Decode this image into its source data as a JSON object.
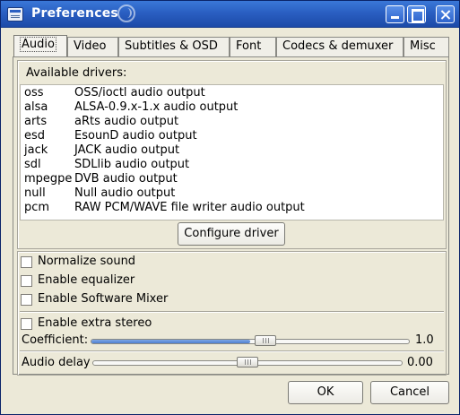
{
  "window": {
    "title": "Preferences"
  },
  "tabs": [
    "Audio",
    "Video",
    "Subtitles & OSD",
    "Font",
    "Codecs & demuxer",
    "Misc"
  ],
  "audio": {
    "drivers_label": "Available drivers:",
    "drivers": [
      {
        "name": "oss",
        "description": "OSS/ioctl audio output"
      },
      {
        "name": "alsa",
        "description": "ALSA-0.9.x-1.x audio output"
      },
      {
        "name": "arts",
        "description": "aRts audio output"
      },
      {
        "name": "esd",
        "description": "EsounD audio output"
      },
      {
        "name": "jack",
        "description": "JACK audio output"
      },
      {
        "name": "sdl",
        "description": "SDLlib audio output"
      },
      {
        "name": "mpegpe",
        "description": "DVB audio output"
      },
      {
        "name": "null",
        "description": "Null audio output"
      },
      {
        "name": "pcm",
        "description": "RAW PCM/WAVE file writer audio output"
      }
    ],
    "configure_button": "Configure driver",
    "options": [
      {
        "label": "Normalize sound",
        "checked": false
      },
      {
        "label": "Enable equalizer",
        "checked": false
      },
      {
        "label": "Enable Software Mixer",
        "checked": false
      }
    ],
    "extra_stereo": {
      "label": "Enable extra stereo",
      "checked": false
    },
    "coefficient": {
      "label": "Coefficient:",
      "value": "1.0",
      "fraction": 0.5
    },
    "audio_delay": {
      "label": "Audio delay",
      "value": "0.00",
      "fraction": 0.5
    }
  },
  "buttons": {
    "ok": "OK",
    "cancel": "Cancel"
  }
}
